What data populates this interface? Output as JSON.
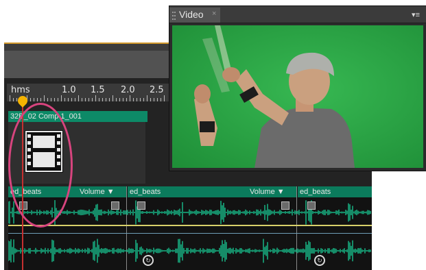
{
  "timeline": {
    "ruler_labels": [
      "hms",
      "1.0",
      "1.5",
      "2.0",
      "2.5"
    ],
    "video_track": {
      "clip_name": "32B_02 Comp 1_001"
    },
    "audio_clips": [
      {
        "name": "ed_beats",
        "volume_label": "Volume ▼"
      },
      {
        "name": "ed_beats",
        "volume_label": "Volume ▼"
      },
      {
        "name": "ed_beats",
        "volume_label": ""
      }
    ]
  },
  "video_panel": {
    "tab_title": "Video",
    "close_glyph": "×",
    "menu_glyph": "▾≡"
  },
  "colors": {
    "track_green": "#0d8a67",
    "green_screen": "#26a242",
    "playhead": "#f5b300",
    "highlight_ellipse": "#d8447e"
  },
  "icons": [
    "film-icon",
    "grip-icon",
    "close-icon",
    "panel-menu-icon",
    "playhead-icon",
    "keyframe-icon",
    "sync-icon"
  ]
}
